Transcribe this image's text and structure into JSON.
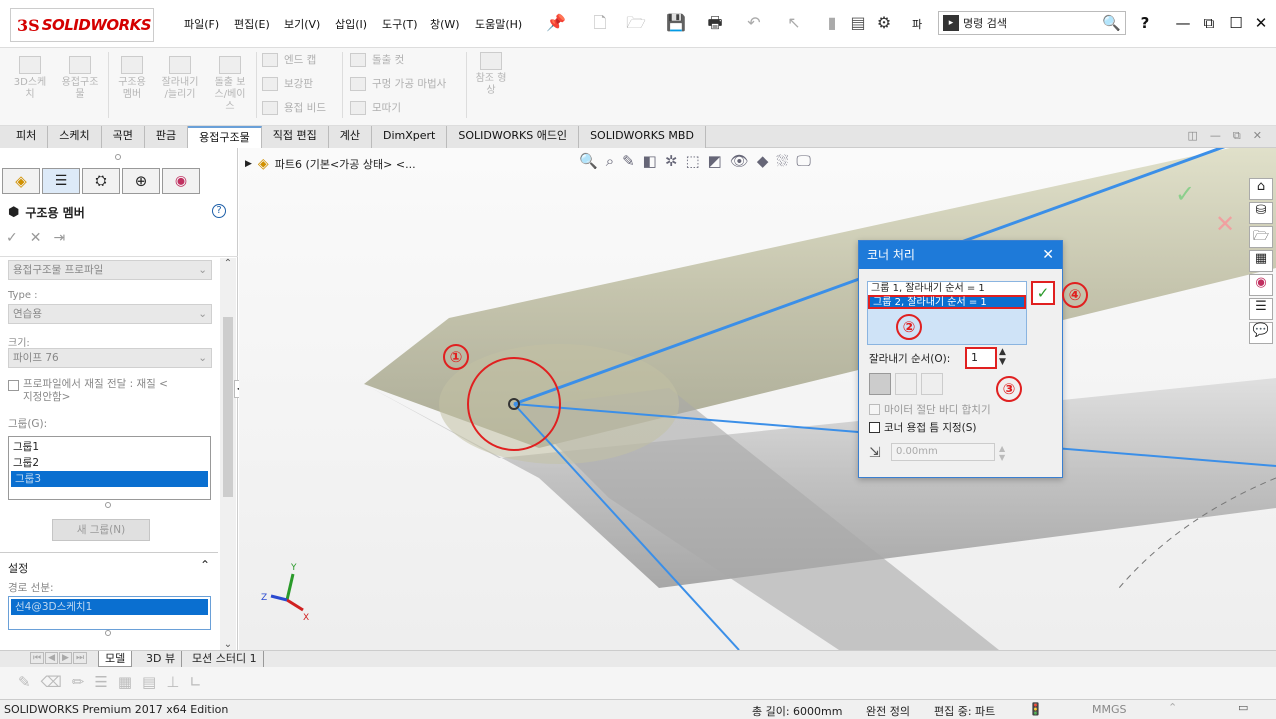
{
  "app": {
    "logo_ds": "3S",
    "logo_text": "SOLIDWORKS"
  },
  "menu": [
    "파일(F)",
    "편집(E)",
    "보기(V)",
    "삽입(I)",
    "도구(T)",
    "창(W)",
    "도움말(H)"
  ],
  "toolbar": {
    "overflow_label": "파",
    "search_placeholder": "명령 검색",
    "help_label": "?"
  },
  "ribbon": {
    "sketch3d": "3D스케\n치",
    "weldment": "용접구조\n물",
    "structural_member": "구조용\n멤버",
    "trim_extend": "잘라내기\n/늘리기",
    "extruded_boss": "돌출 보\n스/베이\n스",
    "end_cap": "엔드 캡",
    "gusset": "보강판",
    "weld_bead": "용접 비드",
    "extruded_cut": "돌출 컷",
    "hole_wizard": "구멍 가공 마법사",
    "chamfer": "모따기",
    "ref_geometry": "참조 형\n상"
  },
  "tabs": [
    "피처",
    "스케치",
    "곡면",
    "판금",
    "용접구조물",
    "직접 편집",
    "계산",
    "DimXpert",
    "SOLIDWORKS 애드인",
    "SOLIDWORKS MBD"
  ],
  "active_tab": "용접구조물",
  "panel": {
    "title": "구조용 멤버",
    "profile_placeholder": "용접구조물 프로파일",
    "type_label": "Type :",
    "type_value": "연습용",
    "size_label": "크기:",
    "size_value": "파이프 76",
    "transfer_material": "프로파일에서 재질 전달 : 재질 <\n지정안함>",
    "groups_label": "그룹(G):",
    "groups": [
      "그룹1",
      "그룹2",
      "그룹3"
    ],
    "selected_group": "그룹3",
    "new_group_button": "새 그룹(N)",
    "settings_label": "설정",
    "path_segments_label": "경로 선분:",
    "path_segment_value": "선4@3D스케치1"
  },
  "tree": {
    "part_label": "파트6  (기본<가공 상태> <..."
  },
  "dialog": {
    "title": "코너 처리",
    "rows": [
      "그룹 1, 잘라내기 순서 = 1",
      "그룹 2, 잘라내기 순서 = 1"
    ],
    "trim_order_label": "잘라내기 순서(O):",
    "trim_order_value": "1",
    "miter_label": "마이터 절단 바디 합치기",
    "weld_gap_label": "코너 용접 틈 지정(S)",
    "gap_value": "0.00mm"
  },
  "callouts": [
    "①",
    "②",
    "③",
    "④"
  ],
  "bottom_tabs": [
    "모델",
    "3D 뷰",
    "모션 스터디 1"
  ],
  "status": {
    "edition": "SOLIDWORKS Premium 2017 x64 Edition",
    "total_length": "총 길이: 6000mm",
    "definition": "완전 정의",
    "editing": "편집 중: 파트",
    "units": "MMGS"
  },
  "colors": {
    "accent": "#1e7ad9",
    "callout": "#e02020",
    "sketch_line": "#3b8fe8",
    "selection": "#0a6fd0"
  }
}
